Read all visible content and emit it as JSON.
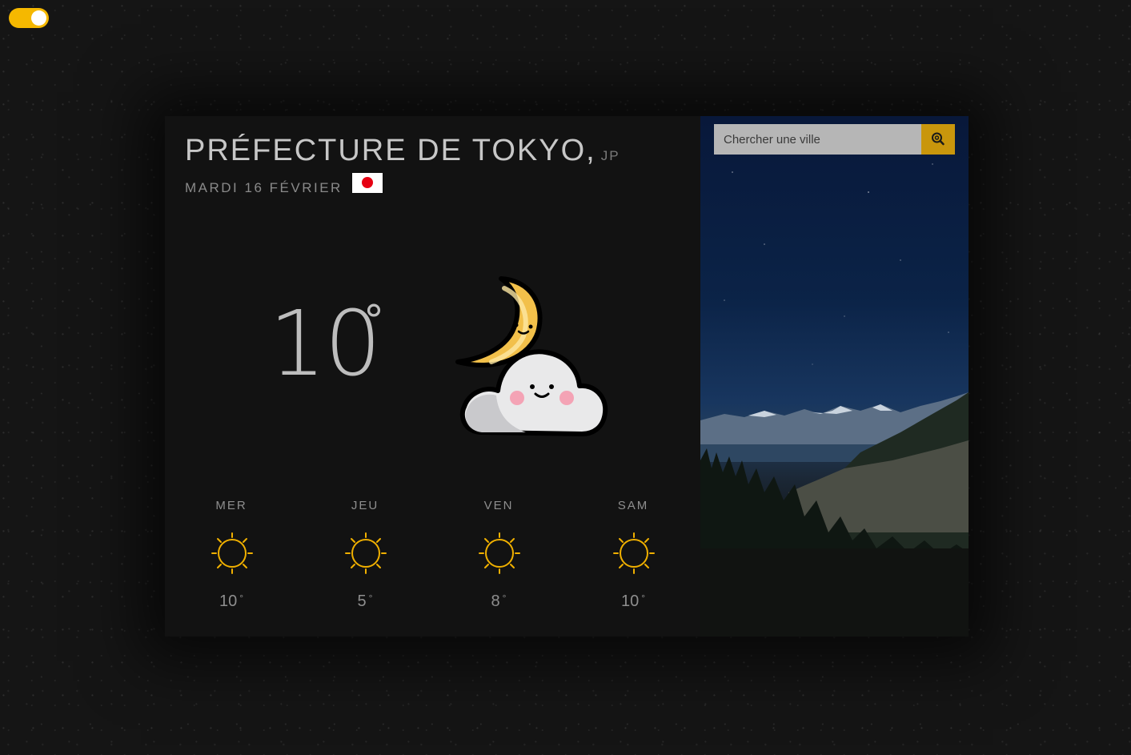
{
  "theme": {
    "accent": "#f5b800",
    "panel": "#121212",
    "toggle_on": true
  },
  "location": {
    "city": "PRÉFECTURE DE TOKYO,",
    "country": "JP",
    "date": "MARDI 16 FÉVRIER",
    "flag_icon": "japan-flag-icon"
  },
  "current": {
    "temperature": "10",
    "degree": "°",
    "icon": "moon-cloud-icon"
  },
  "forecast": [
    {
      "day": "MER",
      "temp": "10",
      "degree": "°",
      "icon": "sun-icon"
    },
    {
      "day": "JEU",
      "temp": "5",
      "degree": "°",
      "icon": "sun-icon"
    },
    {
      "day": "VEN",
      "temp": "8",
      "degree": "°",
      "icon": "sun-icon"
    },
    {
      "day": "SAM",
      "temp": "10",
      "degree": "°",
      "icon": "sun-icon"
    }
  ],
  "search": {
    "placeholder": "Chercher une ville",
    "value": "",
    "button_icon": "search-icon"
  }
}
